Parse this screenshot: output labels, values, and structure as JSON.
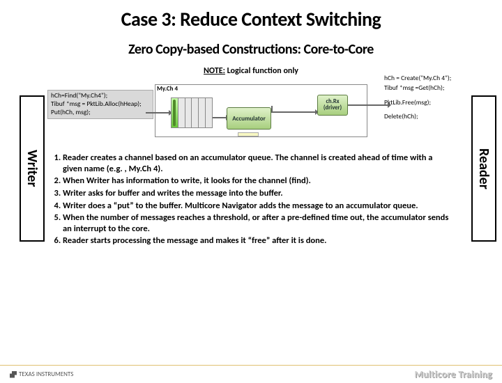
{
  "title": "Case 3: Reduce Context Switching",
  "subtitle": "Zero Copy-based Constructions: Core-to-Core",
  "note_prefix": "NOTE:",
  "note_text": " Logical function only",
  "writer_label": "Writer",
  "reader_label": "Reader",
  "writer_code": {
    "l1": "hCh=Find(\"My.Ch4\");",
    "l2": "Tibuf *msg = PktLib.Alloc(hHeap);",
    "l3": "Put(hCh, msg);"
  },
  "reader_code": {
    "l1": "hCh = Create(\"My.Ch 4\");",
    "l2": "Tibuf *msg =Get(hCh);",
    "l3": "PktLib.Free(msg);",
    "l4": "Delete(hCh);"
  },
  "diagram": {
    "channel_label": "My.Ch 4",
    "accum_label": "Accumulator",
    "chrx_label": "ch.Rx\n(driver)"
  },
  "steps": {
    "s1": "Reader creates a channel based on an accumulator queue. The channel is created ahead of time with a given name (e.g. , My.Ch 4).",
    "s2": "When Writer has information to write, it looks for the channel (find).",
    "s3": "Writer asks for buffer and writes the message into the buffer.",
    "s4": "Writer does a “put” to the buffer. Multicore Navigator adds the message to an accumulator queue.",
    "s5": "When the number of messages reaches a threshold, or after a pre-defined time out, the accumulator sends an interrupt to the core.",
    "s6": "Reader starts processing the message and makes it “free” after it is done."
  },
  "footer": {
    "brand": "TEXAS INSTRUMENTS",
    "course": "Multicore Training"
  }
}
